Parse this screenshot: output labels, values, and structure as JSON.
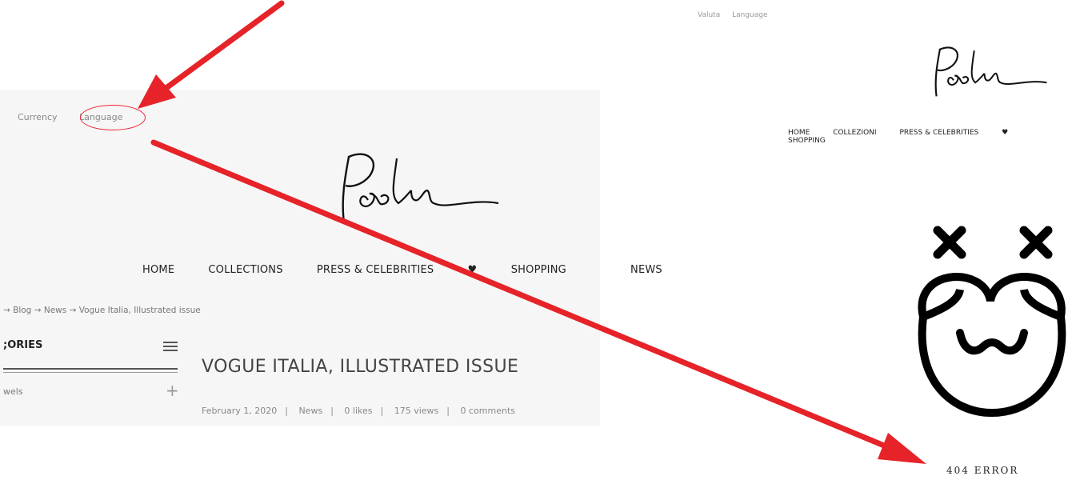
{
  "left": {
    "currency": "Currency",
    "language": "Language",
    "nav": [
      "HOME",
      "COLLECTIONS",
      "PRESS & CELEBRITIES",
      "SHOPPING",
      "NEWS"
    ],
    "breadcrumb": [
      "Blog",
      "News",
      "Vogue Italia, Illustrated issue"
    ],
    "categories": ";ORIES",
    "category_item": "wels",
    "post_title": "VOGUE ITALIA, ILLUSTRATED ISSUE",
    "meta": [
      "February 1, 2020",
      "News",
      "0 likes",
      "175 views",
      "0 comments"
    ]
  },
  "right": {
    "valuta": "Valuta",
    "language": "Language",
    "nav": [
      "HOME",
      "COLLEZIONI",
      "PRESS & CELEBRITIES",
      "SHOPPING"
    ],
    "error": "404 ERROR"
  },
  "colors": {
    "arrow": "#e52328",
    "text": "#222222"
  },
  "icons": [
    "hamburger-icon",
    "plus-icon",
    "heart-icon",
    "dead-face-icon",
    "arrow-icon"
  ]
}
